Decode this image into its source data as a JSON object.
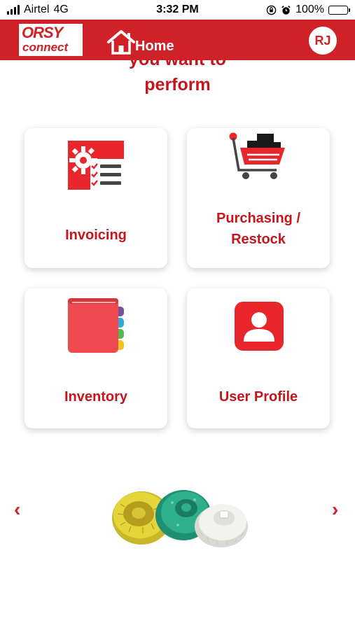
{
  "status_bar": {
    "carrier": "Airtel",
    "network": "4G",
    "time": "3:32 PM",
    "battery": "100%"
  },
  "header": {
    "logo_line1": "ORSY",
    "logo_line2": "connect",
    "title": "Home",
    "user_initials": "RJ"
  },
  "prompt": {
    "line1": "you want to",
    "line2": "perform"
  },
  "tiles": [
    {
      "label": "Invoicing",
      "icon": "invoice-gear-checklist-icon"
    },
    {
      "label_line1": "Purchasing /",
      "label_line2": "Restock",
      "icon": "shopping-cart-icon"
    },
    {
      "label": "Inventory",
      "icon": "book-icon"
    },
    {
      "label": "User Profile",
      "icon": "user-profile-icon"
    }
  ],
  "carousel": {
    "prev": "‹",
    "next": "›",
    "image": "abrasive-discs-product"
  },
  "colors": {
    "brand_red": "#cf2127",
    "text_red": "#c4161c"
  }
}
